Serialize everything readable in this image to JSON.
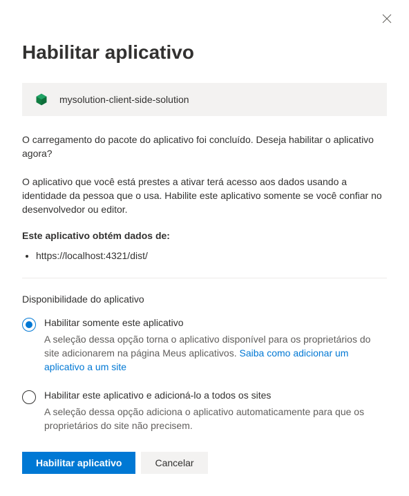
{
  "dialog": {
    "title": "Habilitar aplicativo",
    "app_name": "mysolution-client-side-solution",
    "intro": "O carregamento do pacote do aplicativo foi concluído. Deseja habilitar o aplicativo agora?",
    "trust_warning": "O aplicativo que você está prestes a ativar terá acesso aos dados usando a identidade da pessoa que o usa. Habilite este aplicativo somente se você confiar no desenvolvedor ou editor.",
    "data_sources_heading": "Este aplicativo obtém dados de:",
    "data_sources": [
      "https://localhost:4321/dist/"
    ],
    "availability_heading": "Disponibilidade do aplicativo",
    "options": [
      {
        "label": "Habilitar somente este aplicativo",
        "description_prefix": "A seleção dessa opção torna o aplicativo disponível para os proprietários do site adicionarem na página Meus aplicativos. ",
        "link_text": "Saiba como adicionar um aplicativo a um site",
        "selected": true
      },
      {
        "label": "Habilitar este aplicativo e adicioná-lo a todos os sites",
        "description": "A seleção dessa opção adiciona o aplicativo automaticamente para que os proprietários do site não precisem.",
        "selected": false
      }
    ],
    "buttons": {
      "primary": "Habilitar aplicativo",
      "cancel": "Cancelar"
    }
  }
}
